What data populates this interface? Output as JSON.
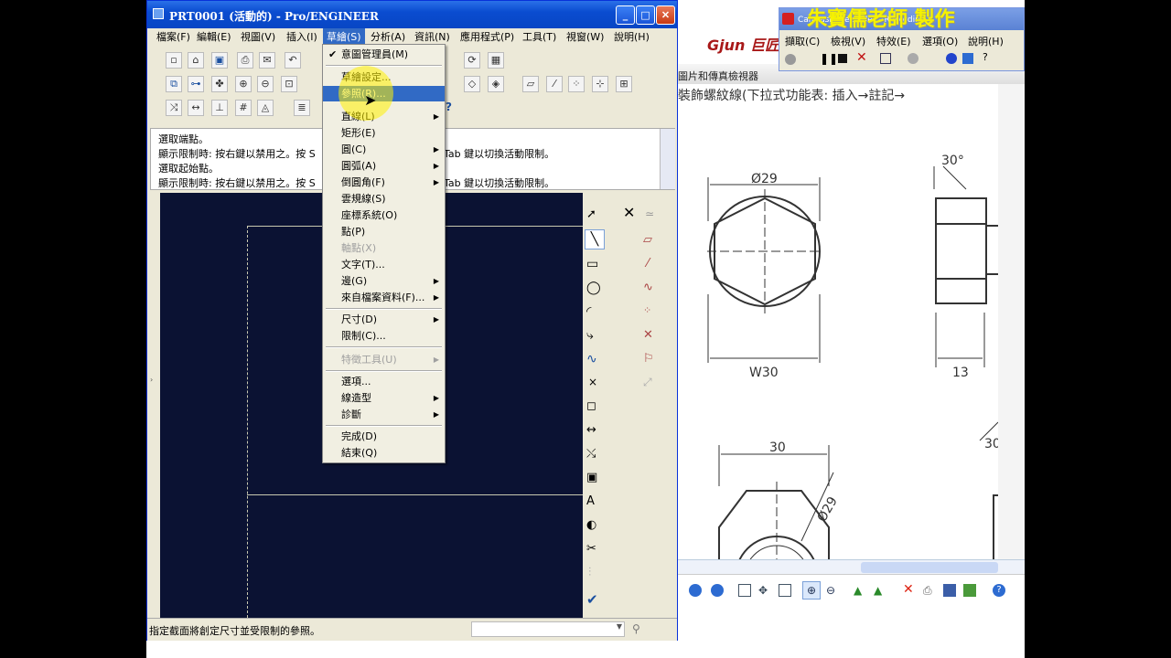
{
  "proe": {
    "title": "PRT0001 (活動的) - Pro/ENGINEER",
    "min_label": "_",
    "max_label": "□",
    "close_label": "✕",
    "menus": [
      "檔案(F)",
      "編輯(E)",
      "視圖(V)",
      "插入(I)",
      "草繪(S)",
      "分析(A)",
      "資訊(N)",
      "應用程式(P)",
      "工具(T)",
      "視窗(W)",
      "說明(H)"
    ],
    "messages": [
      "選取端點。",
      "顯示限制時: 按右鍵以禁用之。按 S",
      "選取起始點。",
      "顯示限制時: 按右鍵以禁用之。按 S"
    ],
    "messages_tail": [
      "Tab 鍵以切換活動限制。",
      "Tab 鍵以切換活動限制。"
    ],
    "status_text": "指定截面將創定尺寸並受限制的參照。"
  },
  "dropdown": {
    "items": [
      {
        "label": "意圖管理員(M)",
        "checked": true
      },
      {
        "label": "草繪設定..."
      },
      {
        "label": "參照(R)...",
        "selected": true
      },
      {
        "label": "直線(L)",
        "sub": true
      },
      {
        "label": "矩形(E)"
      },
      {
        "label": "圓(C)",
        "sub": true
      },
      {
        "label": "圓弧(A)",
        "sub": true
      },
      {
        "label": "倒圓角(F)",
        "sub": true
      },
      {
        "label": "雲規線(S)"
      },
      {
        "label": "座標系統(O)"
      },
      {
        "label": "點(P)"
      },
      {
        "label": "軸點(X)",
        "disabled": true
      },
      {
        "label": "文字(T)..."
      },
      {
        "label": "邊(G)",
        "sub": true
      },
      {
        "label": "來自檔案資料(F)...",
        "sub": true
      },
      {
        "label": "尺寸(D)",
        "sub": true
      },
      {
        "label": "限制(C)..."
      },
      {
        "label": "特徵工具(U)",
        "sub": true,
        "disabled": true
      },
      {
        "label": "選項..."
      },
      {
        "label": "線造型",
        "sub": true
      },
      {
        "label": "診斷",
        "sub": true
      },
      {
        "label": "完成(D)"
      },
      {
        "label": "結束(Q)"
      }
    ]
  },
  "camtasia": {
    "title": "Camtasia Recorder - Recording",
    "overlay_text": "朱寶儒老師 製作",
    "menus": [
      "擷取(C)",
      "檢視(V)",
      "特效(E)",
      "選項(O)",
      "說明(H)"
    ]
  },
  "viewer": {
    "brand": "Gjun 巨匠",
    "title": "圖片和傳真檢視器",
    "heading": "裝飾螺紋線(下拉式功能表: 插入→註記→",
    "dims": {
      "d1": "Ø29",
      "d2": "30°",
      "d3": "W30",
      "d4": "13",
      "d5": "30",
      "d6": "Ø29",
      "d7": "30"
    }
  }
}
